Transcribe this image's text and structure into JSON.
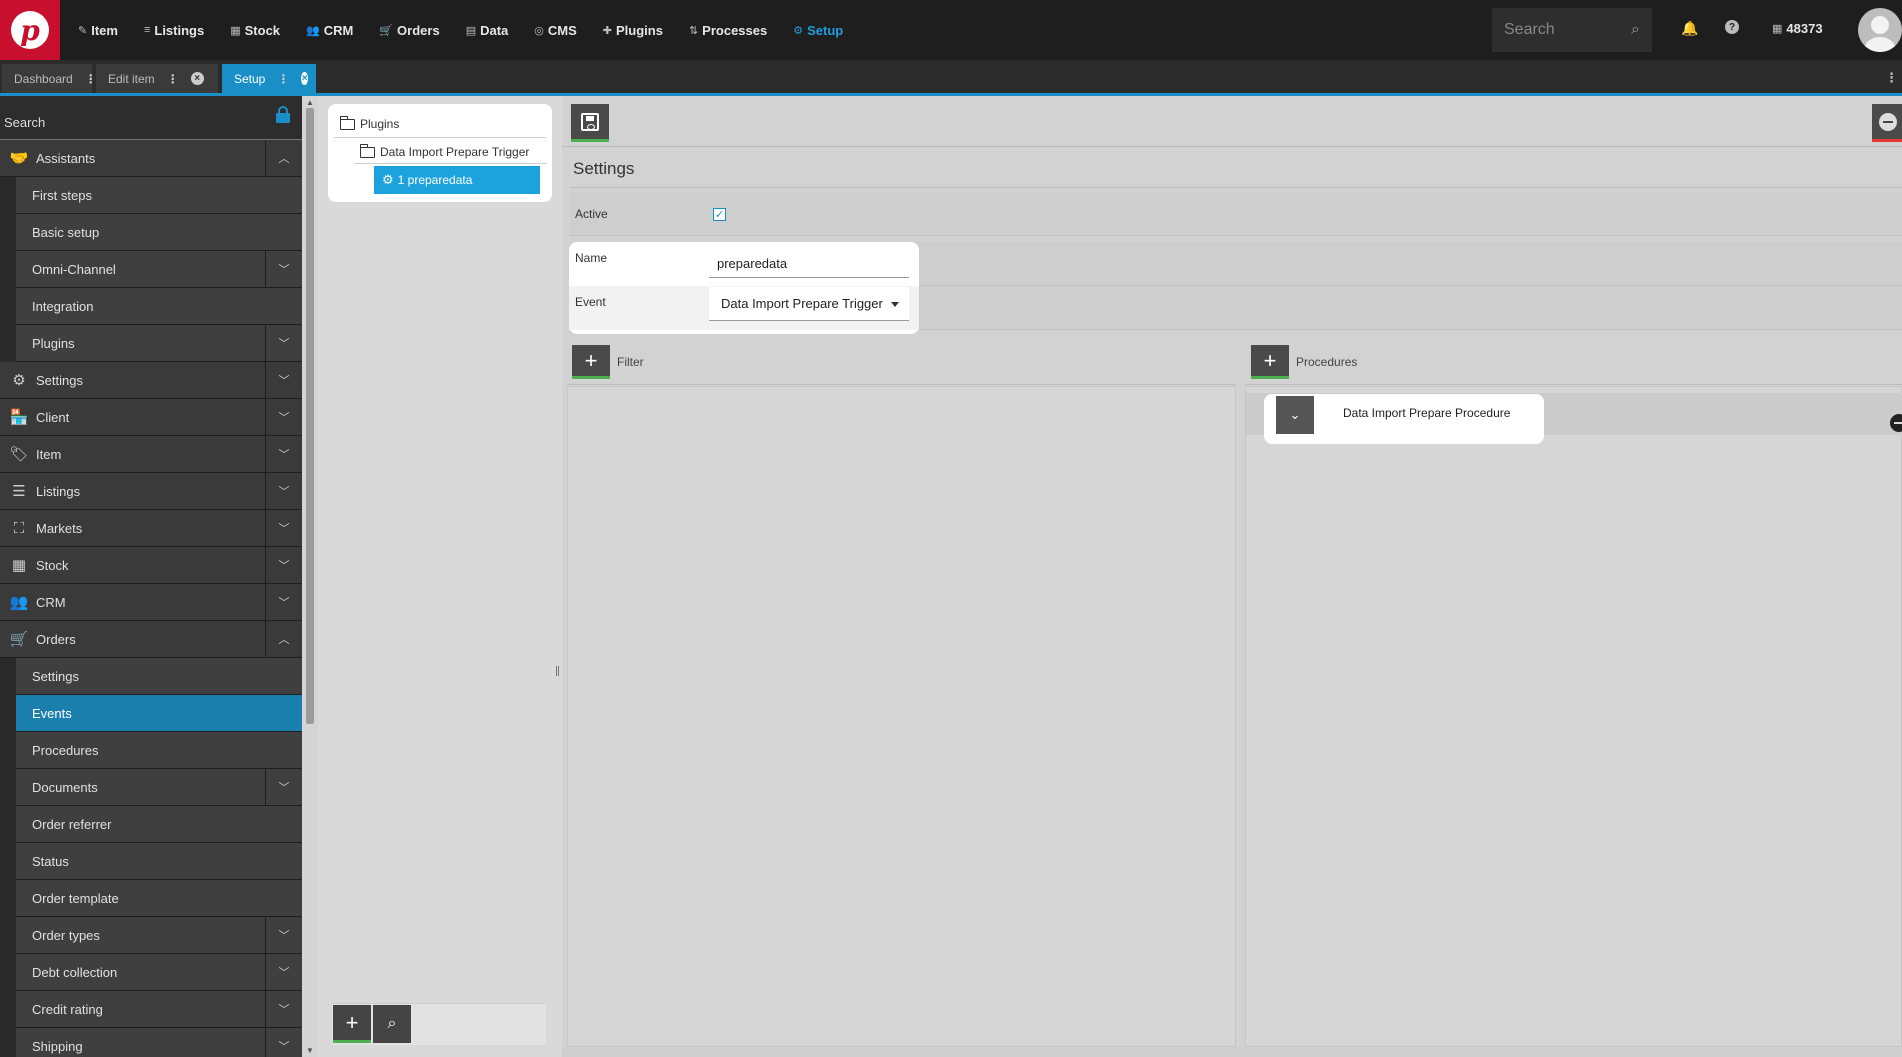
{
  "topnav": {
    "logo_letter": "p",
    "menu": [
      {
        "label": "Item",
        "icon": "tag-icon",
        "glyph": "✎"
      },
      {
        "label": "Listings",
        "icon": "listings-icon",
        "glyph": "≡"
      },
      {
        "label": "Stock",
        "icon": "stock-icon",
        "glyph": "▦"
      },
      {
        "label": "CRM",
        "icon": "people-icon",
        "glyph": "👥"
      },
      {
        "label": "Orders",
        "icon": "cart-icon",
        "glyph": "🛒"
      },
      {
        "label": "Data",
        "icon": "database-icon",
        "glyph": "▤"
      },
      {
        "label": "CMS",
        "icon": "globe-icon",
        "glyph": "◎"
      },
      {
        "label": "Plugins",
        "icon": "puzzle-icon",
        "glyph": "✚"
      },
      {
        "label": "Processes",
        "icon": "processes-icon",
        "glyph": "⇅"
      },
      {
        "label": "Setup",
        "icon": "gear-icon",
        "glyph": "⚙",
        "active": true
      }
    ],
    "search_placeholder": "Search",
    "account_id": "48373"
  },
  "tabs": [
    {
      "label": "Dashboard",
      "closable": false
    },
    {
      "label": "Edit item",
      "closable": true
    },
    {
      "label": "Setup",
      "closable": true,
      "active": true
    }
  ],
  "sidebar": {
    "search_placeholder": "Search",
    "items": [
      {
        "label": "Assistants",
        "level": "top",
        "icon": "handshake-icon",
        "glyph": "🤝",
        "chevron": "up"
      },
      {
        "label": "First steps",
        "level": "sub"
      },
      {
        "label": "Basic setup",
        "level": "sub"
      },
      {
        "label": "Omni-Channel",
        "level": "sub",
        "chevron": "down"
      },
      {
        "label": "Integration",
        "level": "sub"
      },
      {
        "label": "Plugins",
        "level": "sub",
        "chevron": "down"
      },
      {
        "label": "Settings",
        "level": "top",
        "icon": "gear-icon",
        "glyph": "⚙",
        "chevron": "down"
      },
      {
        "label": "Client",
        "level": "top",
        "icon": "shop-icon",
        "glyph": "🏪",
        "chevron": "down"
      },
      {
        "label": "Item",
        "level": "top",
        "icon": "tag-icon",
        "glyph": "🏷",
        "chevron": "down"
      },
      {
        "label": "Listings",
        "level": "top",
        "icon": "listings-icon",
        "glyph": "☰",
        "chevron": "down"
      },
      {
        "label": "Markets",
        "level": "top",
        "icon": "markets-icon",
        "glyph": "⛶",
        "chevron": "down"
      },
      {
        "label": "Stock",
        "level": "top",
        "icon": "stock-icon",
        "glyph": "▦",
        "chevron": "down"
      },
      {
        "label": "CRM",
        "level": "top",
        "icon": "people-icon",
        "glyph": "👥",
        "chevron": "down"
      },
      {
        "label": "Orders",
        "level": "top",
        "icon": "cart-icon",
        "glyph": "🛒",
        "chevron": "up"
      },
      {
        "label": "Settings",
        "level": "sub"
      },
      {
        "label": "Events",
        "level": "sub",
        "selected": true
      },
      {
        "label": "Procedures",
        "level": "sub"
      },
      {
        "label": "Documents",
        "level": "sub",
        "chevron": "down"
      },
      {
        "label": "Order referrer",
        "level": "sub"
      },
      {
        "label": "Status",
        "level": "sub"
      },
      {
        "label": "Order template",
        "level": "sub"
      },
      {
        "label": "Order types",
        "level": "sub",
        "chevron": "down"
      },
      {
        "label": "Debt collection",
        "level": "sub",
        "chevron": "down"
      },
      {
        "label": "Credit rating",
        "level": "sub",
        "chevron": "down"
      },
      {
        "label": "Shipping",
        "level": "sub",
        "chevron": "down"
      }
    ]
  },
  "tree": {
    "root": "Plugins",
    "child": "Data Import Prepare Trigger",
    "selected": "1 preparedata"
  },
  "main": {
    "settings_title": "Settings",
    "active_label": "Active",
    "active_checked": true,
    "name_label": "Name",
    "name_value": "preparedata",
    "event_label": "Event",
    "event_value": "Data Import Prepare Trigger",
    "filter_label": "Filter",
    "procedures_label": "Procedures",
    "procedure_item": "Data Import Prepare Procedure"
  },
  "colors": {
    "brand": "#c8102e",
    "accent": "#1a8fc7",
    "selection": "#1ca3de",
    "add_bar": "#4caf50",
    "remove_bar": "#e53935"
  }
}
